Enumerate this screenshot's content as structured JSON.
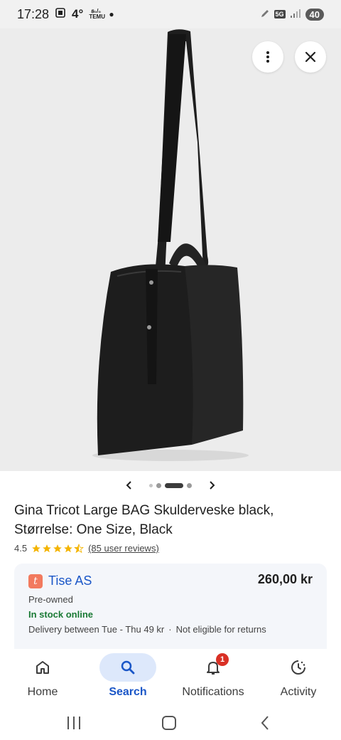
{
  "status_bar": {
    "time": "17:28",
    "temperature": "4°",
    "small_text": "ꞩ₀/₀ TEMU",
    "network": "5G",
    "battery": "40"
  },
  "product": {
    "title": "Gina Tricot Large BAG Skulderveske black, Størrelse: One Size, Black",
    "rating": "4.5",
    "stars_value": 4.5,
    "reviews": "(85 user reviews)"
  },
  "carousel": {
    "current_index": 3,
    "count": 5
  },
  "offer": {
    "seller_logo": "t",
    "seller_name": "Tise AS",
    "price": "260,00 kr",
    "condition": "Pre-owned",
    "stock": "In stock online",
    "delivery": "Delivery between Tue - Thu 49 kr",
    "separator": "·",
    "returns": "Not eligible for returns"
  },
  "bottom_nav": {
    "items": [
      {
        "label": "Home",
        "icon": "home-icon"
      },
      {
        "label": "Search",
        "icon": "search-icon"
      },
      {
        "label": "Notifications",
        "icon": "bell-icon",
        "badge": "1"
      },
      {
        "label": "Activity",
        "icon": "activity-icon"
      }
    ],
    "active_index": 1
  },
  "colors": {
    "accent": "#1a56c7",
    "stock_green": "#1a7a34",
    "star": "#f4b400",
    "badge_red": "#d93025"
  }
}
